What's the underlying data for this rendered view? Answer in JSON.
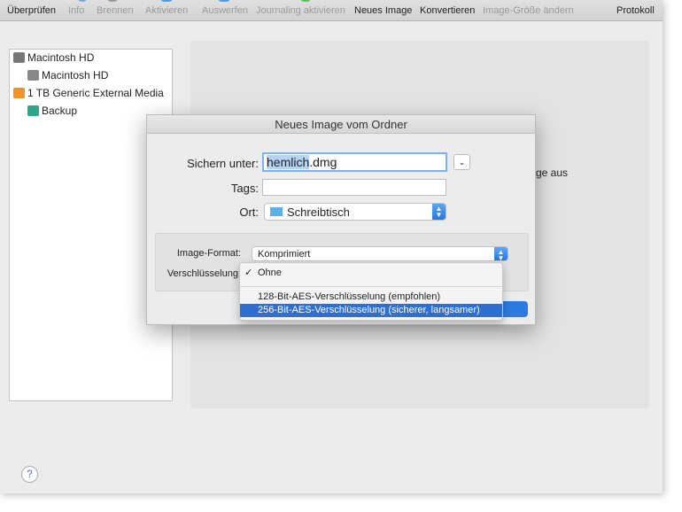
{
  "toolbar": {
    "items": [
      {
        "label": "Überprüfen",
        "enabled": true
      },
      {
        "label": "Info",
        "enabled": false
      },
      {
        "label": "Brennen",
        "enabled": false
      },
      {
        "label": "Aktivieren",
        "enabled": false
      },
      {
        "label": "Auswerfen",
        "enabled": false
      },
      {
        "label": "Journaling aktivieren",
        "enabled": false
      },
      {
        "label": "Neues Image",
        "enabled": true
      },
      {
        "label": "Konvertieren",
        "enabled": true
      },
      {
        "label": "Image-Größe ändern",
        "enabled": false
      },
      {
        "label": "Protokoll",
        "enabled": true
      }
    ]
  },
  "sidebar": {
    "items": [
      {
        "label": "Macintosh HD",
        "icon": "internal-disk-icon"
      },
      {
        "label": "Macintosh HD",
        "icon": "volume-icon"
      },
      {
        "label": "1 TB Generic External Media",
        "icon": "external-disk-icon"
      },
      {
        "label": "Backup",
        "icon": "time-machine-volume-icon"
      }
    ]
  },
  "pane": {
    "partial_text": "ge aus"
  },
  "help": {
    "label": "?"
  },
  "dialog": {
    "title": "Neues Image vom Ordner",
    "save_as_label": "Sichern unter:",
    "save_as_selected": "hemlich",
    "save_as_rest": ".dmg",
    "tags_label": "Tags:",
    "tags_value": "",
    "location_label": "Ort:",
    "location_value": "Schreibtisch",
    "format_label": "Image-Format:",
    "format_value": "Komprimiert",
    "encryption_label": "Verschlüsselung:",
    "encryption_menu": {
      "checkmark": "✓",
      "options": [
        "Ohne",
        "128-Bit-AES-Verschlüsselung (empfohlen)",
        "256-Bit-AES-Verschlüsselung (sicherer, langsamer)"
      ],
      "selected": "Ohne",
      "highlighted": "256-Bit-AES-Verschlüsselung (sicherer, langsamer)"
    }
  },
  "colors": {
    "accent": "#2f6fd1",
    "selection": "#b4d3f5"
  }
}
